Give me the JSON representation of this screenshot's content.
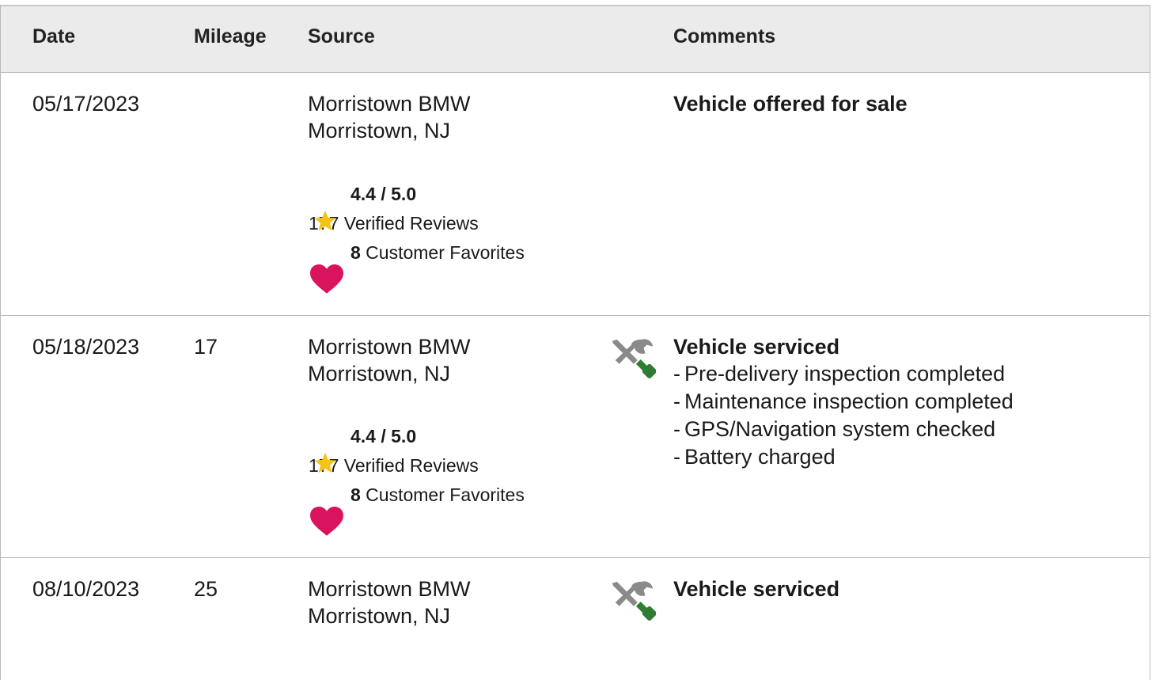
{
  "header": {
    "date": "Date",
    "mileage": "Mileage",
    "source": "Source",
    "comments": "Comments"
  },
  "rows": [
    {
      "date": "05/17/2023",
      "mileage": "",
      "source_name": "Morristown BMW",
      "source_location": "Morristown, NJ",
      "rating": "4.4 / 5.0",
      "reviews_count": "177",
      "reviews_label": " Verified Reviews",
      "favorites_count": "8",
      "favorites_label": " Customer Favorites",
      "comment_title": "Vehicle offered for sale",
      "comment_items": []
    },
    {
      "date": "05/18/2023",
      "mileage": "17",
      "source_name": "Morristown BMW",
      "source_location": "Morristown, NJ",
      "rating": "4.4 / 5.0",
      "reviews_count": "177",
      "reviews_label": " Verified Reviews",
      "favorites_count": "8",
      "favorites_label": " Customer Favorites",
      "comment_title": "Vehicle serviced",
      "comment_items": [
        "Pre-delivery inspection completed",
        "Maintenance inspection completed",
        "GPS/Navigation system checked",
        "Battery charged"
      ]
    },
    {
      "date": "08/10/2023",
      "mileage": "25",
      "source_name": "Morristown BMW",
      "source_location": "Morristown, NJ",
      "comment_title": "Vehicle serviced"
    }
  ],
  "colors": {
    "header_bg": "#ebebeb",
    "border": "#b8b8b8",
    "star": "#f5c21b",
    "heart": "#d9135d",
    "tool_grey": "#8a8a8a",
    "tool_green": "#2e7d32"
  },
  "icons": {
    "star": "star-icon",
    "heart": "heart-icon",
    "service": "tools-icon"
  }
}
